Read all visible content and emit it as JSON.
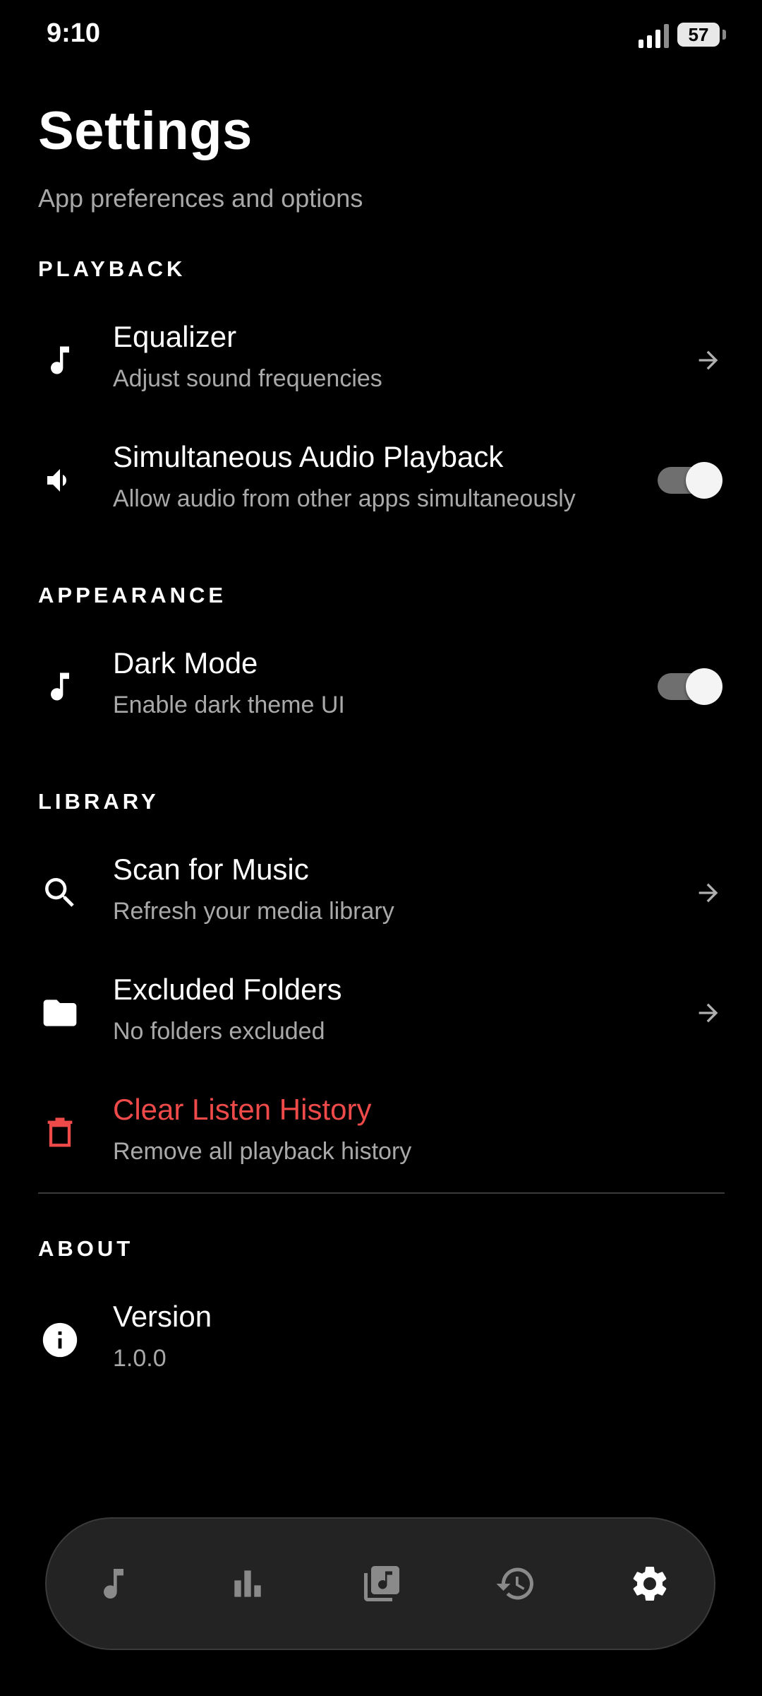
{
  "status": {
    "time": "9:10",
    "battery": "57"
  },
  "header": {
    "title": "Settings",
    "subtitle": "App preferences and options"
  },
  "sections": {
    "playback": {
      "label": "PLAYBACK",
      "equalizer": {
        "title": "Equalizer",
        "subtitle": "Adjust sound frequencies"
      },
      "simultaneous": {
        "title": "Simultaneous Audio Playback",
        "subtitle": "Allow audio from other apps simultaneously",
        "enabled": true
      }
    },
    "appearance": {
      "label": "APPEARANCE",
      "dark_mode": {
        "title": "Dark Mode",
        "subtitle": "Enable dark theme UI",
        "enabled": true
      }
    },
    "library": {
      "label": "LIBRARY",
      "scan": {
        "title": "Scan for Music",
        "subtitle": "Refresh your media library"
      },
      "excluded": {
        "title": "Excluded Folders",
        "subtitle": "No folders excluded"
      },
      "clear_history": {
        "title": "Clear Listen History",
        "subtitle": "Remove all playback history"
      }
    },
    "about": {
      "label": "ABOUT",
      "version": {
        "title": "Version",
        "subtitle": "1.0.0"
      }
    }
  },
  "nav": {
    "items": [
      "music-note-icon",
      "bar-chart-icon",
      "library-music-icon",
      "history-icon",
      "gear-icon"
    ],
    "active": "gear-icon"
  },
  "colors": {
    "danger": "#ef4a4a",
    "muted": "#a9a9a9",
    "background": "#000000",
    "nav_bg": "#232323"
  }
}
